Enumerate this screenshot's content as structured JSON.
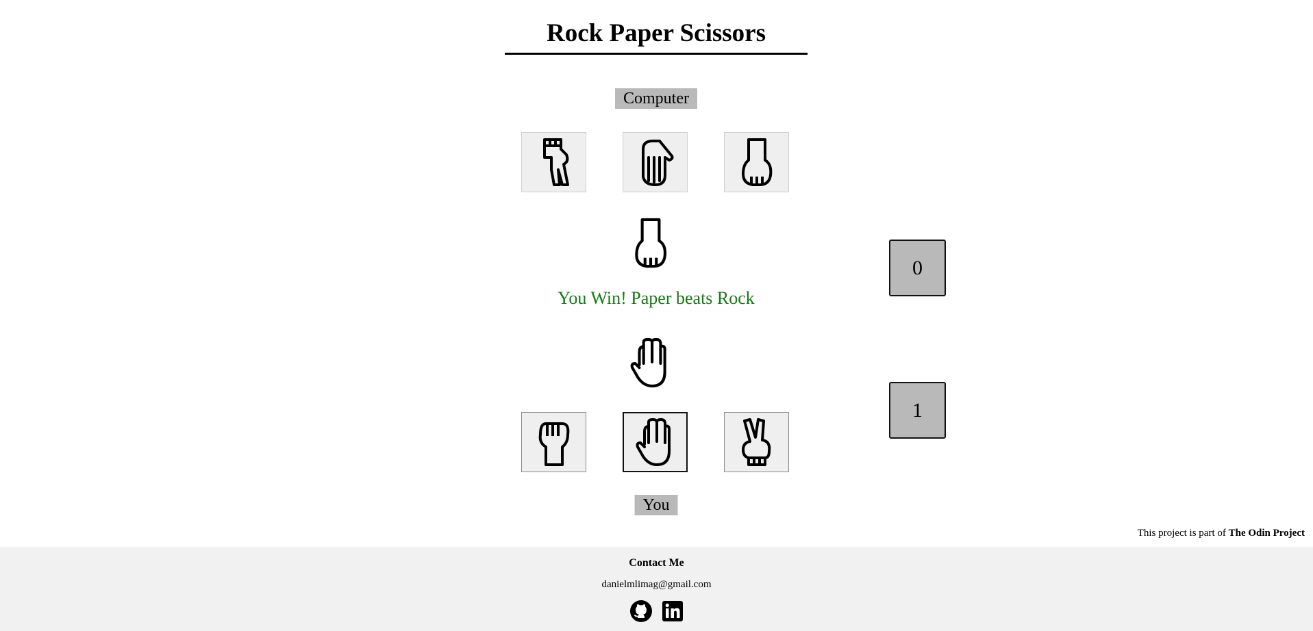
{
  "header": {
    "title": "Rock Paper Scissors"
  },
  "computer": {
    "label": "Computer"
  },
  "player": {
    "label": "You"
  },
  "result": {
    "message": "You Win! Paper beats Rock",
    "color": "#127a12"
  },
  "scores": {
    "computer": "0",
    "player": "1"
  },
  "credit": {
    "prefix": "This project is part of ",
    "project": "The Odin Project"
  },
  "footer": {
    "contact_title": "Contact Me",
    "email": "danielmlimag@gmail.com"
  }
}
